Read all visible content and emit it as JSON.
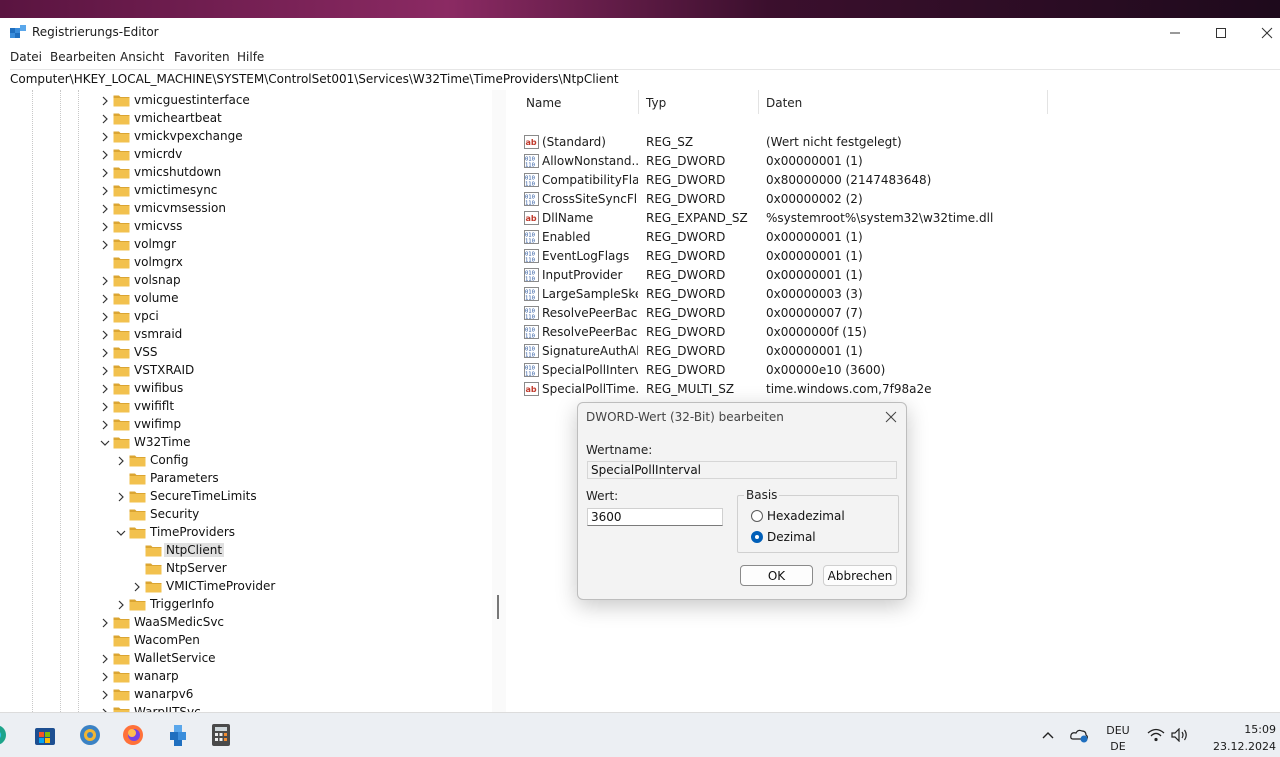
{
  "window": {
    "title": "Registrierungs-Editor",
    "menu": [
      "Datei",
      "Bearbeiten",
      "Ansicht",
      "Favoriten",
      "Hilfe"
    ],
    "address": "Computer\\HKEY_LOCAL_MACHINE\\SYSTEM\\ControlSet001\\Services\\W32Time\\TimeProviders\\NtpClient"
  },
  "tree": {
    "nodes": [
      {
        "label": "vmicguestinterface",
        "level": 0,
        "chevron": "right"
      },
      {
        "label": "vmicheartbeat",
        "level": 0,
        "chevron": "right"
      },
      {
        "label": "vmickvpexchange",
        "level": 0,
        "chevron": "right"
      },
      {
        "label": "vmicrdv",
        "level": 0,
        "chevron": "right"
      },
      {
        "label": "vmicshutdown",
        "level": 0,
        "chevron": "right"
      },
      {
        "label": "vmictimesync",
        "level": 0,
        "chevron": "right"
      },
      {
        "label": "vmicvmsession",
        "level": 0,
        "chevron": "right"
      },
      {
        "label": "vmicvss",
        "level": 0,
        "chevron": "right"
      },
      {
        "label": "volmgr",
        "level": 0,
        "chevron": "right"
      },
      {
        "label": "volmgrx",
        "level": 0,
        "chevron": "none"
      },
      {
        "label": "volsnap",
        "level": 0,
        "chevron": "right"
      },
      {
        "label": "volume",
        "level": 0,
        "chevron": "right"
      },
      {
        "label": "vpci",
        "level": 0,
        "chevron": "right"
      },
      {
        "label": "vsmraid",
        "level": 0,
        "chevron": "right"
      },
      {
        "label": "VSS",
        "level": 0,
        "chevron": "right"
      },
      {
        "label": "VSTXRAID",
        "level": 0,
        "chevron": "right"
      },
      {
        "label": "vwifibus",
        "level": 0,
        "chevron": "right"
      },
      {
        "label": "vwififlt",
        "level": 0,
        "chevron": "right"
      },
      {
        "label": "vwifimp",
        "level": 0,
        "chevron": "right"
      },
      {
        "label": "W32Time",
        "level": 0,
        "chevron": "down"
      },
      {
        "label": "Config",
        "level": 1,
        "chevron": "right"
      },
      {
        "label": "Parameters",
        "level": 1,
        "chevron": "none"
      },
      {
        "label": "SecureTimeLimits",
        "level": 1,
        "chevron": "right"
      },
      {
        "label": "Security",
        "level": 1,
        "chevron": "none"
      },
      {
        "label": "TimeProviders",
        "level": 1,
        "chevron": "down"
      },
      {
        "label": "NtpClient",
        "level": 2,
        "chevron": "none",
        "selected": true
      },
      {
        "label": "NtpServer",
        "level": 2,
        "chevron": "none"
      },
      {
        "label": "VMICTimeProvider",
        "level": 2,
        "chevron": "right"
      },
      {
        "label": "TriggerInfo",
        "level": 1,
        "chevron": "right"
      },
      {
        "label": "WaaSMedicSvc",
        "level": 0,
        "chevron": "right"
      },
      {
        "label": "WacomPen",
        "level": 0,
        "chevron": "none"
      },
      {
        "label": "WalletService",
        "level": 0,
        "chevron": "right"
      },
      {
        "label": "wanarp",
        "level": 0,
        "chevron": "right"
      },
      {
        "label": "wanarpv6",
        "level": 0,
        "chevron": "right"
      },
      {
        "label": "WarpJITSvc",
        "level": 0,
        "chevron": "right"
      }
    ]
  },
  "values": {
    "columns": [
      "Name",
      "Typ",
      "Daten"
    ],
    "rows": [
      {
        "icon": "string",
        "name": "(Standard)",
        "type": "REG_SZ",
        "data": "(Wert nicht festgelegt)"
      },
      {
        "icon": "binary",
        "name": "AllowNonstand...",
        "type": "REG_DWORD",
        "data": "0x00000001 (1)"
      },
      {
        "icon": "binary",
        "name": "CompatibilityFla...",
        "type": "REG_DWORD",
        "data": "0x80000000 (2147483648)"
      },
      {
        "icon": "binary",
        "name": "CrossSiteSyncFl...",
        "type": "REG_DWORD",
        "data": "0x00000002 (2)"
      },
      {
        "icon": "string",
        "name": "DllName",
        "type": "REG_EXPAND_SZ",
        "data": "%systemroot%\\system32\\w32time.dll"
      },
      {
        "icon": "binary",
        "name": "Enabled",
        "type": "REG_DWORD",
        "data": "0x00000001 (1)"
      },
      {
        "icon": "binary",
        "name": "EventLogFlags",
        "type": "REG_DWORD",
        "data": "0x00000001 (1)"
      },
      {
        "icon": "binary",
        "name": "InputProvider",
        "type": "REG_DWORD",
        "data": "0x00000001 (1)"
      },
      {
        "icon": "binary",
        "name": "LargeSampleSkew",
        "type": "REG_DWORD",
        "data": "0x00000003 (3)"
      },
      {
        "icon": "binary",
        "name": "ResolvePeerBac...",
        "type": "REG_DWORD",
        "data": "0x00000007 (7)"
      },
      {
        "icon": "binary",
        "name": "ResolvePeerBac...",
        "type": "REG_DWORD",
        "data": "0x0000000f (15)"
      },
      {
        "icon": "binary",
        "name": "SignatureAuthAl...",
        "type": "REG_DWORD",
        "data": "0x00000001 (1)"
      },
      {
        "icon": "binary",
        "name": "SpecialPollInterval",
        "type": "REG_DWORD",
        "data": "0x00000e10 (3600)"
      },
      {
        "icon": "string",
        "name": "SpecialPollTime...",
        "type": "REG_MULTI_SZ",
        "data": "time.windows.com,7f98a2e"
      }
    ]
  },
  "dialog": {
    "title": "DWORD-Wert (32-Bit) bearbeiten",
    "name_label": "Wertname:",
    "name_value": "SpecialPollInterval",
    "value_label": "Wert:",
    "value_value": "3600",
    "base_label": "Basis",
    "hex_label": "Hexadezimal",
    "dec_label": "Dezimal",
    "selected_base": "Dezimal",
    "ok_label": "OK",
    "cancel_label": "Abbrechen"
  },
  "taskbar": {
    "language": "DEU",
    "layout": "DE",
    "time": "15:09",
    "date": "23.12.2024"
  },
  "colors": {
    "accent": "#005fb8",
    "folder": "#f2c14e",
    "folder_dark": "#dba532"
  }
}
